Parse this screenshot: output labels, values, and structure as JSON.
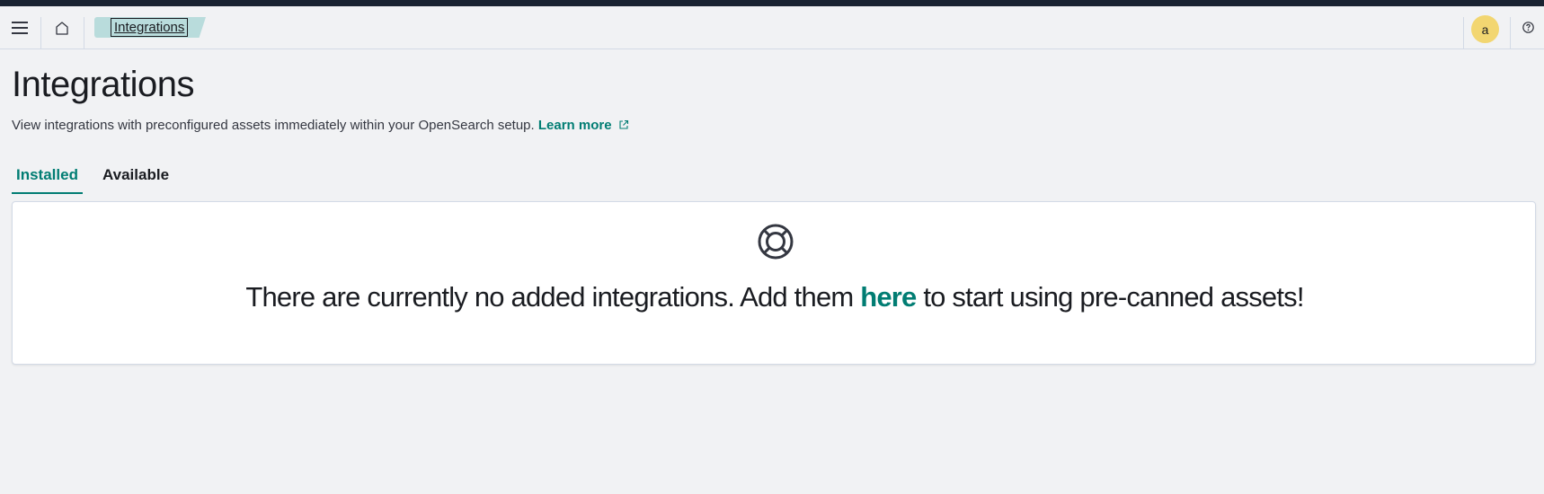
{
  "header": {
    "breadcrumb": "Integrations",
    "avatar_initial": "a"
  },
  "page": {
    "title": "Integrations",
    "description": "View integrations with preconfigured assets immediately within your OpenSearch setup.",
    "learn_more": "Learn more"
  },
  "tabs": [
    {
      "label": "Installed",
      "selected": true
    },
    {
      "label": "Available",
      "selected": false
    }
  ],
  "empty_state": {
    "before": "There are currently no added integrations. Add them ",
    "link": "here",
    "after": " to start using pre-canned assets!"
  },
  "colors": {
    "accent": "#017d73",
    "breadcrumb_bg": "#b9dcdc",
    "avatar_bg": "#f2d671",
    "topbar": "#1a2331"
  },
  "icons": [
    "menu-icon",
    "home-icon",
    "help-icon",
    "external-link-icon",
    "lifebuoy-icon"
  ]
}
